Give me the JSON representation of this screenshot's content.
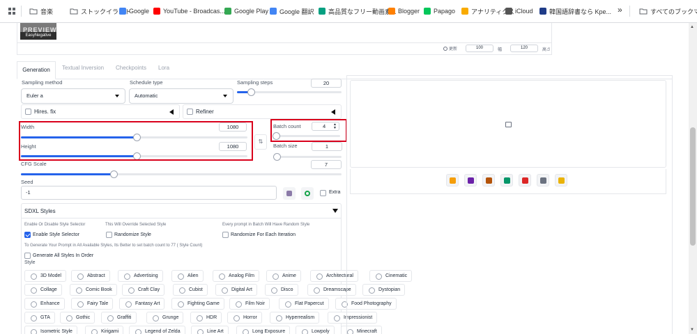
{
  "bookmarks": {
    "items": [
      {
        "label": "音楽",
        "icon": "folder-icon"
      },
      {
        "label": "ストックイラスト",
        "icon": "folder-icon"
      },
      {
        "label": "Google",
        "icon": "google-icon"
      },
      {
        "label": "YouTube - Broadcas...",
        "icon": "youtube-icon"
      },
      {
        "label": "Google Play",
        "icon": "google-play-icon"
      },
      {
        "label": "Google 翻訳",
        "icon": "translate-icon"
      },
      {
        "label": "高品質なフリー動画素...",
        "icon": "video-site-icon"
      },
      {
        "label": "Blogger",
        "icon": "blogger-icon"
      },
      {
        "label": "Papago",
        "icon": "papago-icon"
      },
      {
        "label": "アナリティクス",
        "icon": "analytics-icon"
      },
      {
        "label": "iCloud",
        "icon": "apple-icon"
      },
      {
        "label": "韓国語辞書なら Kpe...",
        "icon": "dictionary-icon"
      }
    ],
    "overflow": "»",
    "all_bookmarks": "すべてのブックマーク"
  },
  "preview": {
    "caption": "EasyNegative",
    "thumb_text": "PREVIEW"
  },
  "card_footer": {
    "refresh": "更新",
    "width_val": "100",
    "width_lbl": "幅",
    "height_val": "120",
    "height_lbl": "高さ"
  },
  "tabs": [
    {
      "label": "Generation"
    },
    {
      "label": "Textual Inversion"
    },
    {
      "label": "Checkpoints"
    },
    {
      "label": "Lora"
    }
  ],
  "sampling": {
    "method_label": "Sampling method",
    "method_value": "Euler a",
    "schedule_label": "Schedule type",
    "schedule_value": "Automatic",
    "steps_label": "Sampling steps",
    "steps_value": "20",
    "steps_fraction": 0.13
  },
  "hires": {
    "label": "Hires. fix"
  },
  "refiner": {
    "label": "Refiner"
  },
  "width": {
    "label": "Width",
    "value": "1080",
    "fraction": 0.51
  },
  "height": {
    "label": "Height",
    "value": "1080",
    "fraction": 0.51
  },
  "swap_icon": "⇅",
  "batch_count": {
    "label": "Batch count",
    "value": "4",
    "fraction": 0.03
  },
  "batch_size": {
    "label": "Batch size",
    "value": "1",
    "fraction": 0.0
  },
  "cfg": {
    "label": "CFG Scale",
    "value": "7",
    "fraction": 0.29
  },
  "seed": {
    "label": "Seed",
    "value": "-1",
    "extra_label": "Extra"
  },
  "sdxl": {
    "title": "SDXL Styles",
    "hint1": "Enable Or Disable Style Selector",
    "hint2": "This Will Override Selected Style",
    "hint3": "Every prompt in Batch Will Have Random Style",
    "enable_label": "Enable Style Selector",
    "randomize_label": "Randomize Style",
    "randomize_each_label": "Randomize For Each Iteration",
    "hint4": "To Generate Your Prompt in All Available Styles, Its Better to set batch count to 77 ( Style Count)",
    "generate_all_label": "Generate All Styles In Order",
    "style_label": "Style",
    "rows": [
      [
        "3D Model",
        "Abstract",
        "Advertising",
        "Alien",
        "Analog Film",
        "Anime",
        "Architectural",
        "Cinematic"
      ],
      [
        "Collage",
        "Comic Book",
        "Craft Clay",
        "Cubist",
        "Digital Art",
        "Disco",
        "Dreamscape",
        "Dystopian"
      ],
      [
        "Enhance",
        "Fairy Tale",
        "Fantasy Art",
        "Fighting Game",
        "Film Noir",
        "Flat Papercut",
        "Food Photography"
      ],
      [
        "GTA",
        "Gothic",
        "Graffiti",
        "Grunge",
        "HDR",
        "Horror",
        "Hyperrealism",
        "Impressionist"
      ],
      [
        "Isometric Style",
        "Kirigami",
        "Legend of Zelda",
        "Line Art",
        "Long Exposure",
        "Lowpoly",
        "Minecraft"
      ]
    ]
  },
  "tool_icons": [
    "folder-icon",
    "save-icon",
    "zip-icon",
    "image-send-icon",
    "inpaint-send-icon",
    "extras-send-icon",
    "sparkle-icon"
  ],
  "colors": {
    "accent": "#2563eb",
    "highlight": "#d9001b"
  }
}
